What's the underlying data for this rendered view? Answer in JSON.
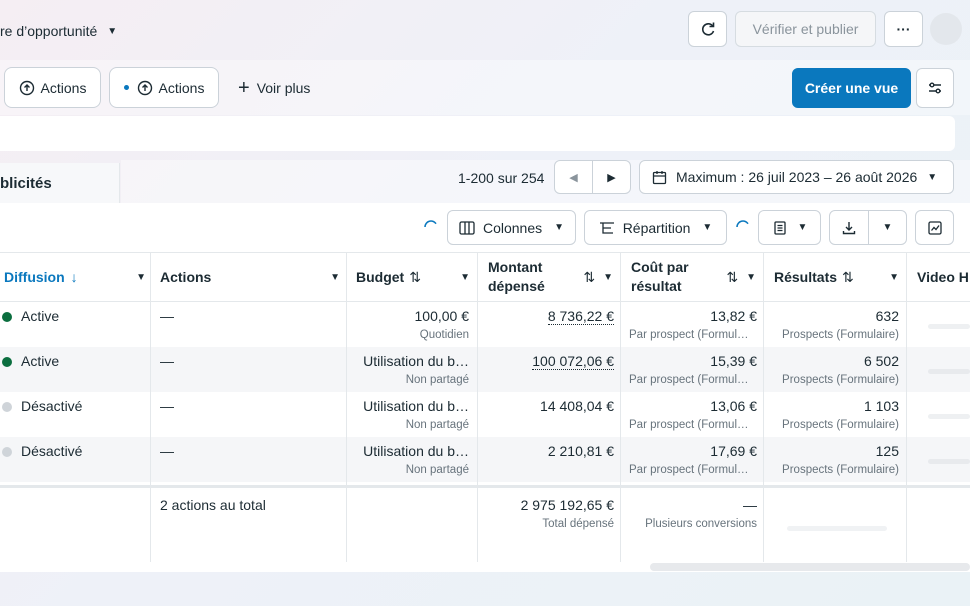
{
  "topbar": {
    "title": "re d’opportunité",
    "verify_publish": "Vérifier et publier",
    "more": "···"
  },
  "toolbar": {
    "chip1": "Actions",
    "chip2": "Actions",
    "see_more": "Voir plus",
    "create_view": "Créer une vue"
  },
  "tabs": {
    "ads_tab": "blicités"
  },
  "pagination": {
    "range": "1-200 sur 254",
    "date_range": "Maximum : 26 juil 2023 – 26 août 2026"
  },
  "controls": {
    "columns": "Colonnes",
    "breakdown": "Répartition"
  },
  "columns": {
    "diffusion": "Diffusion",
    "actions": "Actions",
    "budget": "Budget",
    "spent_line1": "Montant",
    "spent_line2": "dépensé",
    "cost_line1": "Coût par",
    "cost_line2": "résultat",
    "results": "Résultats",
    "video": "Video H"
  },
  "rows": [
    {
      "status": "Active",
      "status_color": "#0b6e3f",
      "actions": "—",
      "budget": "100,00 €",
      "budget_sub": "Quotidien",
      "spent": "8 736,22 €",
      "cost": "13,82 €",
      "cost_sub": "Par prospect (Formul…",
      "results": "632",
      "results_sub": "Prospects (Formulaire)"
    },
    {
      "status": "Active",
      "status_color": "#0b6e3f",
      "actions": "—",
      "budget": "Utilisation du b…",
      "budget_sub": "Non partagé",
      "spent": "100 072,06 €",
      "cost": "15,39 €",
      "cost_sub": "Par prospect (Formul…",
      "results": "6 502",
      "results_sub": "Prospects (Formulaire)"
    },
    {
      "status": "Désactivé",
      "status_color": "#cfd4d9",
      "actions": "—",
      "budget": "Utilisation du b…",
      "budget_sub": "Non partagé",
      "spent": "14 408,04 €",
      "cost": "13,06 €",
      "cost_sub": "Par prospect (Formul…",
      "results": "1 103",
      "results_sub": "Prospects (Formulaire)"
    },
    {
      "status": "Désactivé",
      "status_color": "#cfd4d9",
      "actions": "—",
      "budget": "Utilisation du b…",
      "budget_sub": "Non partagé",
      "spent": "2 210,81 €",
      "cost": "17,69 €",
      "cost_sub": "Par prospect (Formul…",
      "results": "125",
      "results_sub": "Prospects (Formulaire)"
    }
  ],
  "totals": {
    "actions": "2 actions au total",
    "spent": "2 975 192,65 €",
    "spent_sub": "Total dépensé",
    "cost": "—",
    "cost_sub": "Plusieurs conversions"
  }
}
